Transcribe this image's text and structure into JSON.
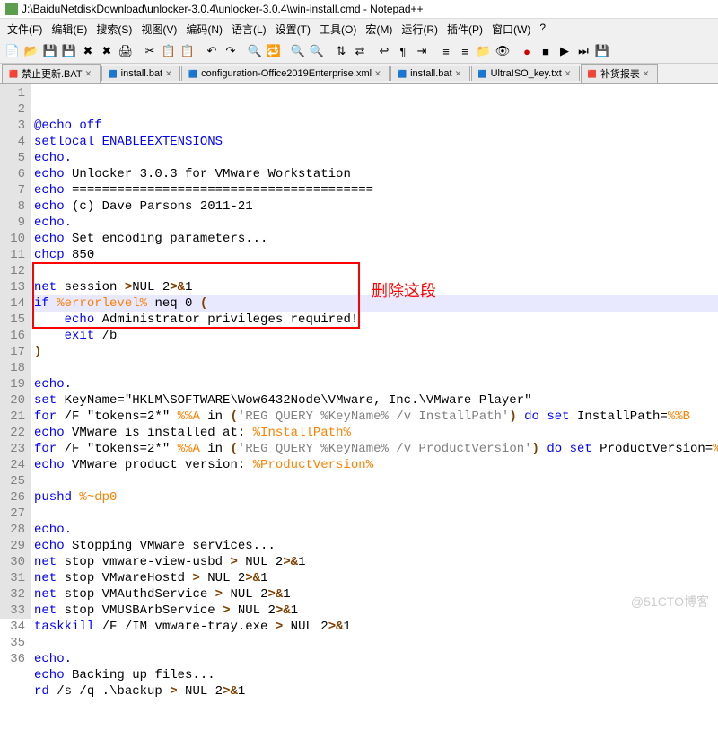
{
  "titlebar": {
    "path": "J:\\BaiduNetdiskDownload\\unlocker-3.0.4\\unlocker-3.0.4\\win-install.cmd - Notepad++"
  },
  "menu": {
    "file": "文件(F)",
    "edit": "编辑(E)",
    "search": "搜索(S)",
    "view": "视图(V)",
    "encoding": "编码(N)",
    "language": "语言(L)",
    "settings": "设置(T)",
    "tools": "工具(O)",
    "macro": "宏(M)",
    "run": "运行(R)",
    "plugins": "插件(P)",
    "window": "窗口(W)",
    "help": "?"
  },
  "tabs": [
    {
      "label": "禁止更新.BAT",
      "active": false,
      "modified": true
    },
    {
      "label": "install.bat",
      "active": false,
      "modified": false
    },
    {
      "label": "configuration-Office2019Enterprise.xml",
      "active": false,
      "modified": false
    },
    {
      "label": "install.bat",
      "active": false,
      "modified": false
    },
    {
      "label": "UltraISO_key.txt",
      "active": false,
      "modified": false
    },
    {
      "label": "补货报表",
      "active": false,
      "modified": true
    }
  ],
  "annotation": {
    "label": "删除这段"
  },
  "watermark": "@51CTO博客",
  "code": {
    "lines": [
      {
        "n": 1,
        "t": "@echo off",
        "cls": "cmd"
      },
      {
        "n": 2,
        "t": "setlocal ENABLEEXTENSIONS",
        "cls": "cmd"
      },
      {
        "n": 3,
        "t": "echo.",
        "cls": "cmd"
      },
      {
        "n": 4,
        "html": "<span class='cmd'>echo</span><span class='plain'> Unlocker 3.0.3 for VMware Workstation</span>"
      },
      {
        "n": 5,
        "html": "<span class='cmd'>echo</span><span class='plain'> ========================================</span>"
      },
      {
        "n": 6,
        "html": "<span class='cmd'>echo</span><span class='plain'> (c) Dave Parsons 2011-21</span>"
      },
      {
        "n": 7,
        "t": "echo.",
        "cls": "cmd"
      },
      {
        "n": 8,
        "html": "<span class='cmd'>echo</span><span class='plain'> Set encoding parameters...</span>"
      },
      {
        "n": 9,
        "html": "<span class='cmd'>chcp</span><span class='plain'> 850</span>"
      },
      {
        "n": 10,
        "t": " "
      },
      {
        "n": 11,
        "html": "<span class='cmd'>net</span><span class='plain'> session </span><span class='op'>&gt;</span><span class='plain'>NUL 2</span><span class='op'>&gt;&amp;</span><span class='plain'>1</span>"
      },
      {
        "n": 12,
        "html": "<span class='cmd'>if</span><span class='plain'> </span><span class='var'>%errorlevel%</span><span class='plain'> neq 0 </span><span class='op'>(</span>",
        "current": true
      },
      {
        "n": 13,
        "html": "<span class='plain'>    </span><span class='cmd'>echo</span><span class='plain'> Administrator privileges required!</span>"
      },
      {
        "n": 14,
        "html": "<span class='plain'>    </span><span class='cmd'>exit</span><span class='plain'> /b</span>"
      },
      {
        "n": 15,
        "html": "<span class='op'>)</span>"
      },
      {
        "n": 16,
        "t": " "
      },
      {
        "n": 17,
        "t": "echo.",
        "cls": "cmd"
      },
      {
        "n": 18,
        "html": "<span class='cmd'>set</span><span class='plain'> KeyName=\"HKLM\\SOFTWARE\\Wow6432Node\\VMware, Inc.\\VMware Player\"</span>"
      },
      {
        "n": 19,
        "html": "<span class='cmd'>for</span><span class='plain'> /F \"tokens=2*\" </span><span class='var'>%%A</span><span class='plain'> in </span><span class='op'>(</span><span class='str'>'REG QUERY %KeyName% /v InstallPath'</span><span class='op'>)</span><span class='plain'> </span><span class='cmd'>do</span><span class='plain'> </span><span class='cmd'>set</span><span class='plain'> InstallPath=</span><span class='var'>%%B</span>"
      },
      {
        "n": 20,
        "html": "<span class='cmd'>echo</span><span class='plain'> VMware is installed at: </span><span class='var'>%InstallPath%</span>"
      },
      {
        "n": 21,
        "html": "<span class='cmd'>for</span><span class='plain'> /F \"tokens=2*\" </span><span class='var'>%%A</span><span class='plain'> in </span><span class='op'>(</span><span class='str'>'REG QUERY %KeyName% /v ProductVersion'</span><span class='op'>)</span><span class='plain'> </span><span class='cmd'>do</span><span class='plain'> </span><span class='cmd'>set</span><span class='plain'> ProductVersion=</span><span class='var'>%%B</span>"
      },
      {
        "n": 22,
        "html": "<span class='cmd'>echo</span><span class='plain'> VMware product version: </span><span class='var'>%ProductVersion%</span>"
      },
      {
        "n": 23,
        "t": " "
      },
      {
        "n": 24,
        "html": "<span class='cmd'>pushd</span><span class='plain'> </span><span class='var'>%~dp0</span>"
      },
      {
        "n": 25,
        "t": " "
      },
      {
        "n": 26,
        "t": "echo.",
        "cls": "cmd"
      },
      {
        "n": 27,
        "html": "<span class='cmd'>echo</span><span class='plain'> Stopping VMware services...</span>"
      },
      {
        "n": 28,
        "html": "<span class='cmd'>net</span><span class='plain'> stop vmware-view-usbd </span><span class='op'>&gt;</span><span class='plain'> NUL 2</span><span class='op'>&gt;&amp;</span><span class='plain'>1</span>"
      },
      {
        "n": 29,
        "html": "<span class='cmd'>net</span><span class='plain'> stop VMwareHostd </span><span class='op'>&gt;</span><span class='plain'> NUL 2</span><span class='op'>&gt;&amp;</span><span class='plain'>1</span>"
      },
      {
        "n": 30,
        "html": "<span class='cmd'>net</span><span class='plain'> stop VMAuthdService </span><span class='op'>&gt;</span><span class='plain'> NUL 2</span><span class='op'>&gt;&amp;</span><span class='plain'>1</span>"
      },
      {
        "n": 31,
        "html": "<span class='cmd'>net</span><span class='plain'> stop VMUSBArbService </span><span class='op'>&gt;</span><span class='plain'> NUL 2</span><span class='op'>&gt;&amp;</span><span class='plain'>1</span>"
      },
      {
        "n": 32,
        "html": "<span class='cmd'>taskkill</span><span class='plain'> /F /IM vmware-tray.exe </span><span class='op'>&gt;</span><span class='plain'> NUL 2</span><span class='op'>&gt;&amp;</span><span class='plain'>1</span>"
      },
      {
        "n": 33,
        "t": " "
      },
      {
        "n": 34,
        "t": "echo.",
        "cls": "cmd"
      },
      {
        "n": 35,
        "html": "<span class='cmd'>echo</span><span class='plain'> Backing up files...</span>"
      },
      {
        "n": 36,
        "html": "<span class='cmd'>rd</span><span class='plain'> /s /q .\\backup </span><span class='op'>&gt;</span><span class='plain'> NUL 2</span><span class='op'>&gt;&amp;</span><span class='plain'>1</span>"
      }
    ]
  }
}
